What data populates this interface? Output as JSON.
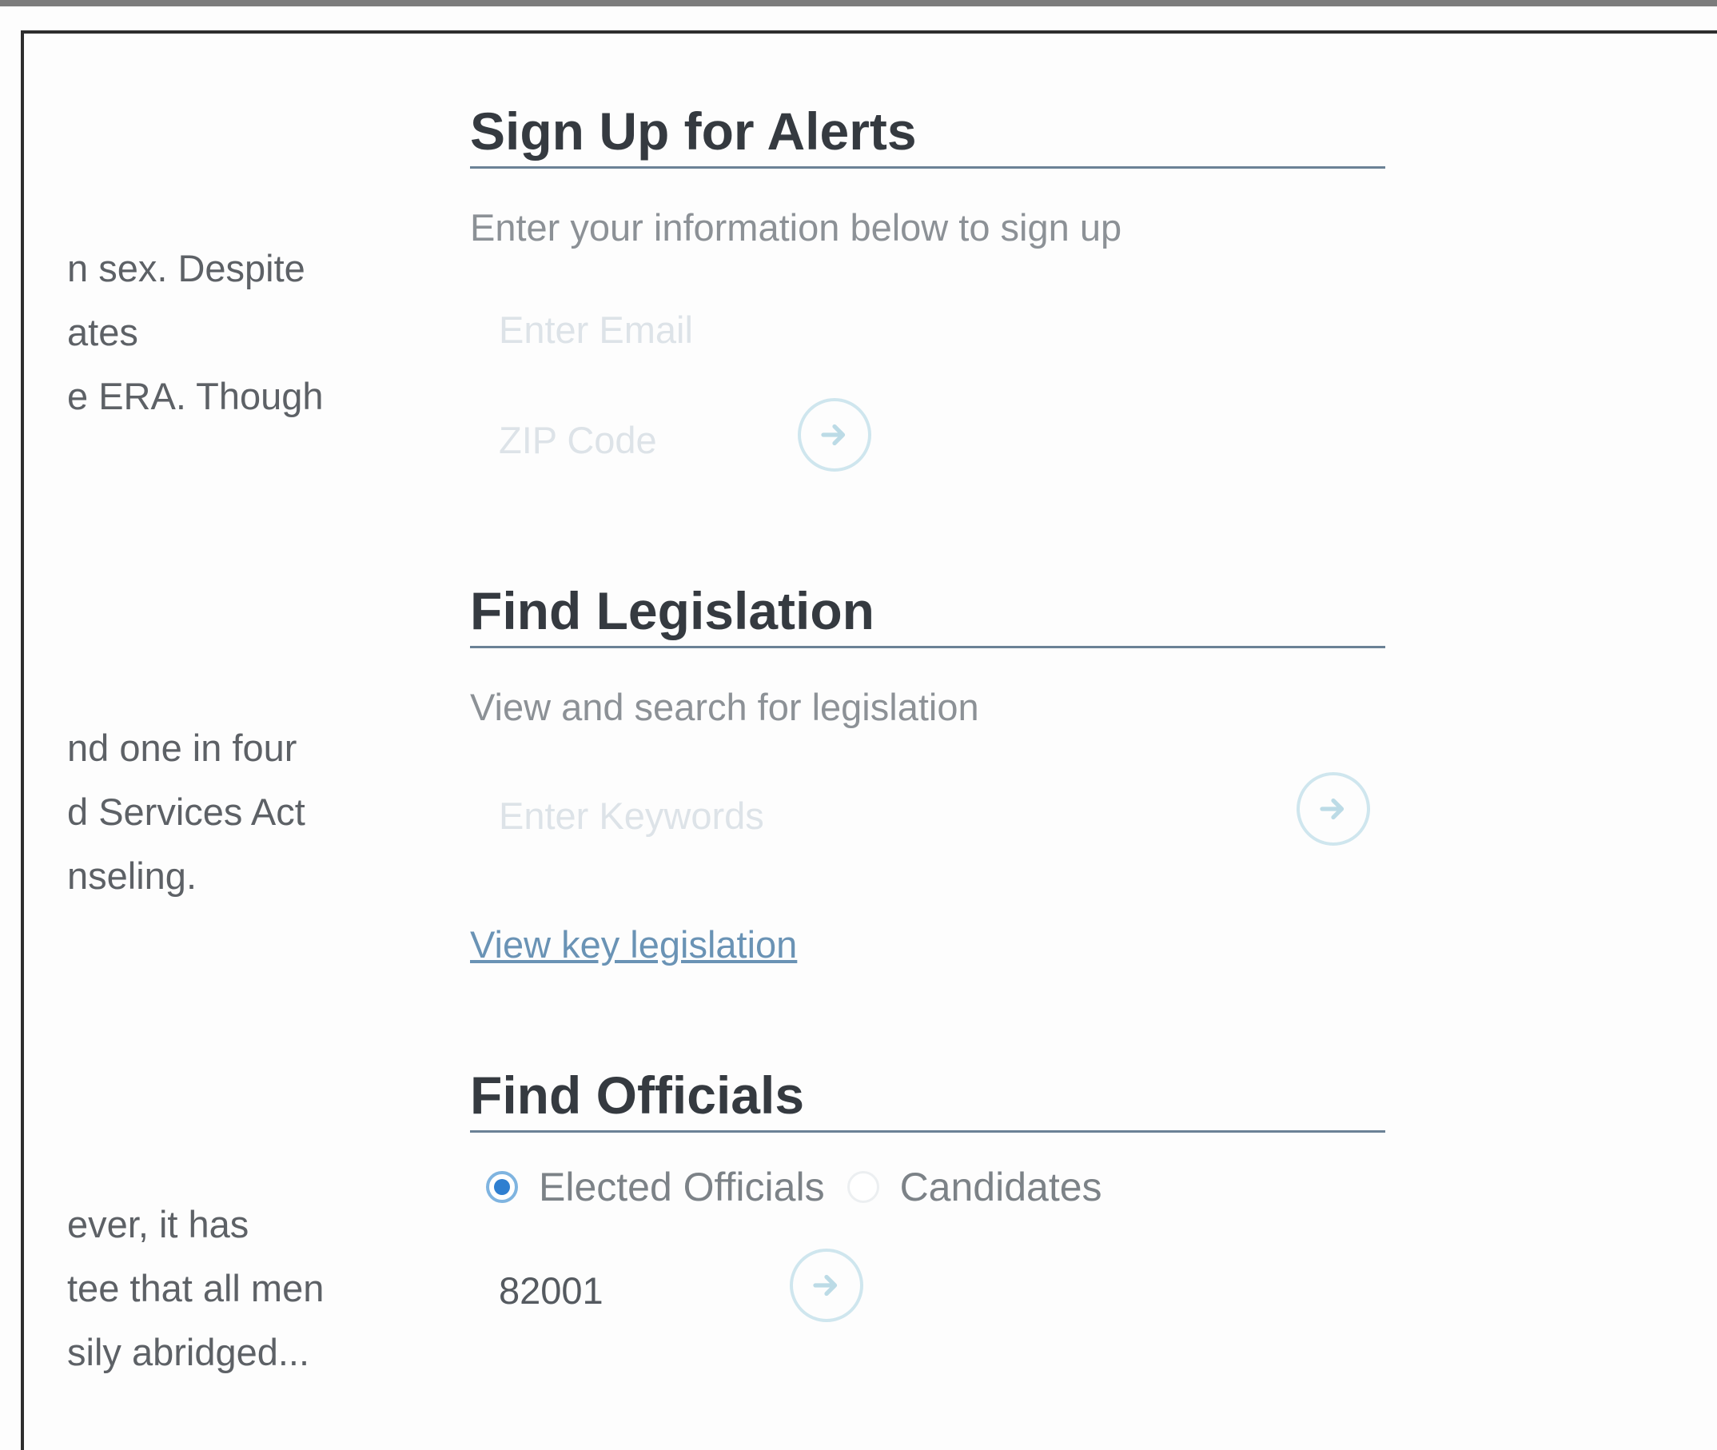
{
  "left_column": {
    "block1": [
      "n sex. Despite",
      "ates",
      "e ERA. Though"
    ],
    "block2": [
      "nd one in four",
      "d Services Act",
      "nseling."
    ],
    "block3": [
      "ever, it has",
      "tee that all men",
      "sily abridged..."
    ]
  },
  "alerts": {
    "title": "Sign Up for Alerts",
    "description": "Enter your information below to sign up",
    "email_placeholder": "Enter Email",
    "zip_placeholder": "ZIP Code",
    "submit_icon": "arrow-right-icon"
  },
  "legislation": {
    "title": "Find Legislation",
    "description": "View and search for legislation",
    "keywords_placeholder": "Enter Keywords",
    "submit_icon": "arrow-right-icon",
    "key_link": "View key legislation"
  },
  "officials": {
    "title": "Find Officials",
    "options": [
      {
        "label": "Elected Officials",
        "selected": true
      },
      {
        "label": "Candidates",
        "selected": false
      }
    ],
    "zip_value": "82001",
    "submit_icon": "arrow-right-icon"
  },
  "colors": {
    "title_text": "#353a40",
    "rule": "#6b8296",
    "link": "#6a93b5",
    "radio_selected": "#2f7fd0",
    "button_ring": "#cfe6ee"
  }
}
